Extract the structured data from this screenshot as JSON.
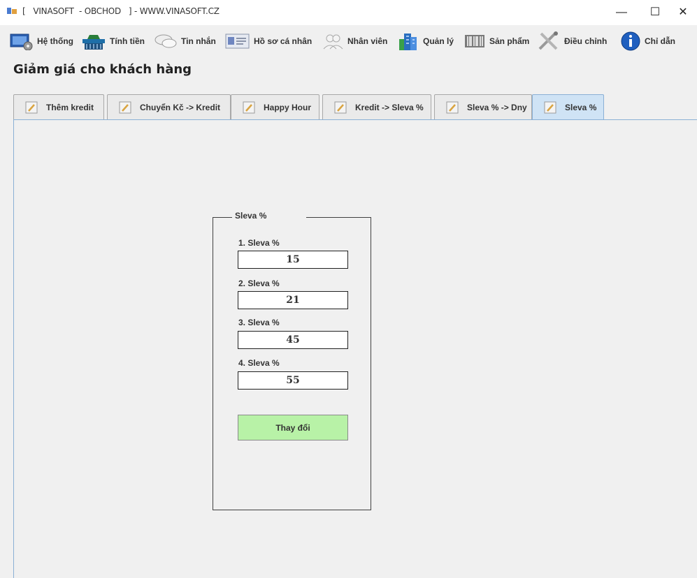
{
  "window": {
    "title": "[   VINASOFT  - OBCHOD   ] - WWW.VINASOFT.CZ",
    "minimize": "—",
    "maximize": "☐",
    "close": "✕"
  },
  "toolbar": {
    "items": [
      {
        "label": "Hệ thống",
        "icon": "system-icon"
      },
      {
        "label": "Tính tiền",
        "icon": "basket-icon"
      },
      {
        "label": "Tin nhắn",
        "icon": "chat-icon"
      },
      {
        "label": "Hồ sơ cá nhân",
        "icon": "profile-card-icon"
      },
      {
        "label": "Nhân viên",
        "icon": "users-icon"
      },
      {
        "label": "Quản lý",
        "icon": "buildings-icon"
      },
      {
        "label": "Sản phẩm",
        "icon": "barcode-icon"
      },
      {
        "label": "Điều chỉnh",
        "icon": "tools-icon"
      },
      {
        "label": "Chỉ dẫn",
        "icon": "info-icon"
      }
    ]
  },
  "page": {
    "title": "Giảm giá cho khách hàng"
  },
  "tabs": [
    {
      "label": "Thêm kredit"
    },
    {
      "label": "Chuyển Kč -> Kredit"
    },
    {
      "label": "Happy Hour"
    },
    {
      "label": "Kredit -> Sleva %"
    },
    {
      "label": "Sleva % -> Dny"
    },
    {
      "label": "Sleva %",
      "active": true
    }
  ],
  "group": {
    "title": "Sleva %",
    "fields": [
      {
        "label": "1. Sleva %",
        "value": "15"
      },
      {
        "label": "2. Sleva %",
        "value": "21"
      },
      {
        "label": "3. Sleva %",
        "value": "45"
      },
      {
        "label": "4. Sleva %",
        "value": "55"
      }
    ],
    "button_label": "Thay đổi"
  },
  "colors": {
    "button_bg": "#b8f2a7",
    "active_tab": "#cfe3f5",
    "background": "#f0f0f0"
  }
}
